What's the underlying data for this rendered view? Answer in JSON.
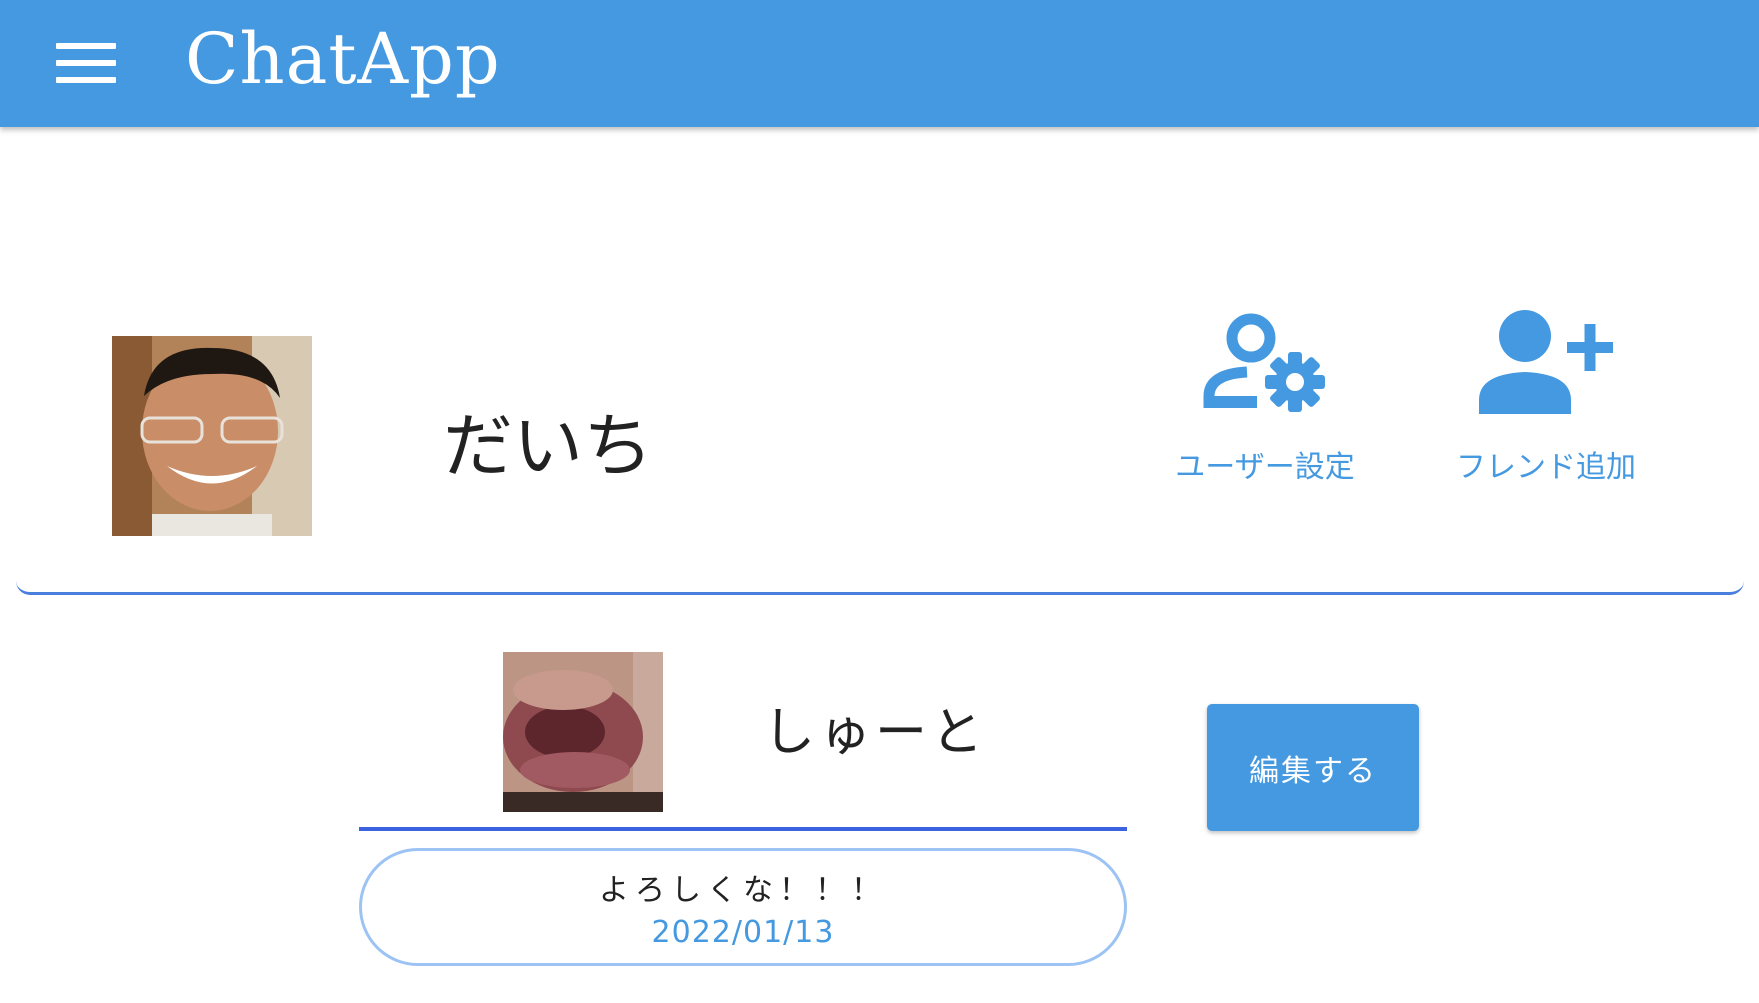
{
  "appbar": {
    "title": "ChatApp",
    "menu_icon": "hamburger-menu-icon",
    "color": "#4599e0"
  },
  "profile": {
    "name": "だいち",
    "actions": [
      {
        "label": "ユーザー設定",
        "icon": "user-settings-icon"
      },
      {
        "label": "フレンド追加",
        "icon": "add-friend-icon"
      }
    ]
  },
  "friend": {
    "name": "しゅーと",
    "edit_label": "編集する",
    "message": {
      "text": "よろしくな！！！",
      "date": "2022/01/13"
    }
  },
  "colors": {
    "accent": "#4599e0",
    "divider": "#3b63e0",
    "bubble_border": "#9cc3f3"
  }
}
